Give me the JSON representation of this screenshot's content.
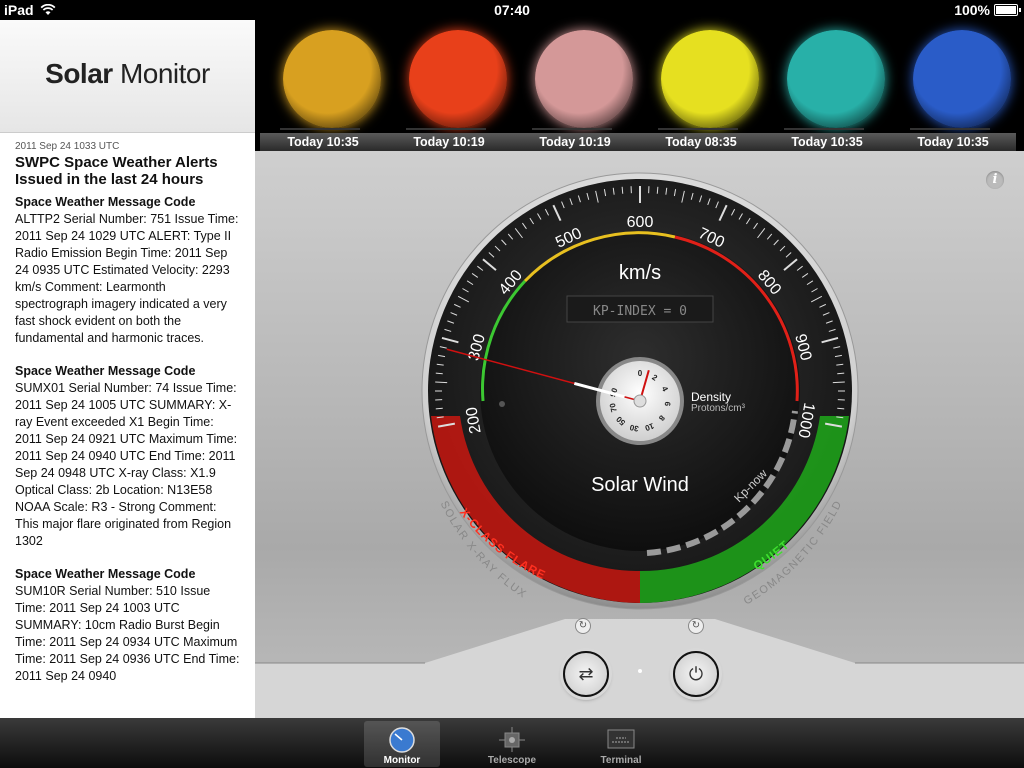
{
  "status": {
    "device": "iPad",
    "time": "07:40",
    "battery": "100%"
  },
  "app": {
    "title_bold": "Solar",
    "title_rest": " Monitor"
  },
  "alerts": {
    "date": "2011 Sep 24 1033 UTC",
    "heading": "SWPC Space Weather Alerts Issued in the last 24 hours",
    "items": [
      {
        "head": "Space Weather Message Code",
        "body": "ALTTP2 Serial Number: 751 Issue Time: 2011 Sep 24 1029 UTC ALERT: Type II Radio Emission Begin Time: 2011 Sep 24 0935 UTC Estimated Velocity: 2293 km/s Comment: Learmonth spectrograph imagery indicated a very fast shock evident on both the fundamental and harmonic traces."
      },
      {
        "head": "Space Weather Message Code",
        "body": "SUMX01 Serial Number: 74 Issue Time: 2011 Sep 24 1005 UTC SUMMARY: X-ray Event exceeded X1 Begin Time: 2011 Sep 24 0921 UTC Maximum Time: 2011 Sep 24 0940 UTC End Time: 2011 Sep 24 0948 UTC X-ray Class: X1.9 Optical Class: 2b Location: N13E58 NOAA Scale: R3 - Strong Comment: This major flare originated from Region 1302"
      },
      {
        "head": "Space Weather Message Code",
        "body": "SUM10R Serial Number: 510 Issue Time: 2011 Sep 24 1003 UTC SUMMARY: 10cm Radio Burst Begin Time: 2011 Sep 24 0934 UTC Maximum Time: 2011 Sep 24 0936 UTC End Time: 2011 Sep 24 0940"
      }
    ]
  },
  "strip": [
    {
      "label": "Today 10:35",
      "color": "#d8a020"
    },
    {
      "label": "Today 10:19",
      "color": "#e8401a"
    },
    {
      "label": "Today 10:19",
      "color": "#d49898"
    },
    {
      "label": "Today 08:35",
      "color": "#e6e020"
    },
    {
      "label": "Today 10:35",
      "color": "#28b0a8"
    },
    {
      "label": "Today 10:35",
      "color": "#2a5cc8"
    }
  ],
  "gauge": {
    "unit": "km/s",
    "kp_display": "KP-INDEX = 0",
    "title": "Solar Wind",
    "density_label": "Density",
    "density_unit": "Protons/cm³",
    "speed_ticks": [
      "200",
      "300",
      "400",
      "500",
      "600",
      "700",
      "800",
      "900",
      "1000"
    ],
    "density_ticks": [
      "0",
      "2",
      "4",
      "6",
      "8",
      "10",
      "30",
      "50",
      "70",
      "90"
    ],
    "speed_value": 300,
    "density_value": 1,
    "left_arc_label": "X-CLASS FLARE",
    "right_arc_label": "QUIET",
    "kp_now_label": "Kp-now",
    "bezel_left": "SOLAR X-RAY FLUX",
    "bezel_right": "GEOMAGNETIC FIELD",
    "colors": {
      "green": "#3cc832",
      "yellow": "#e8c020",
      "red": "#e02018"
    }
  },
  "tabs": [
    {
      "label": "Monitor",
      "active": true
    },
    {
      "label": "Telescope",
      "active": false
    },
    {
      "label": "Terminal",
      "active": false
    }
  ]
}
